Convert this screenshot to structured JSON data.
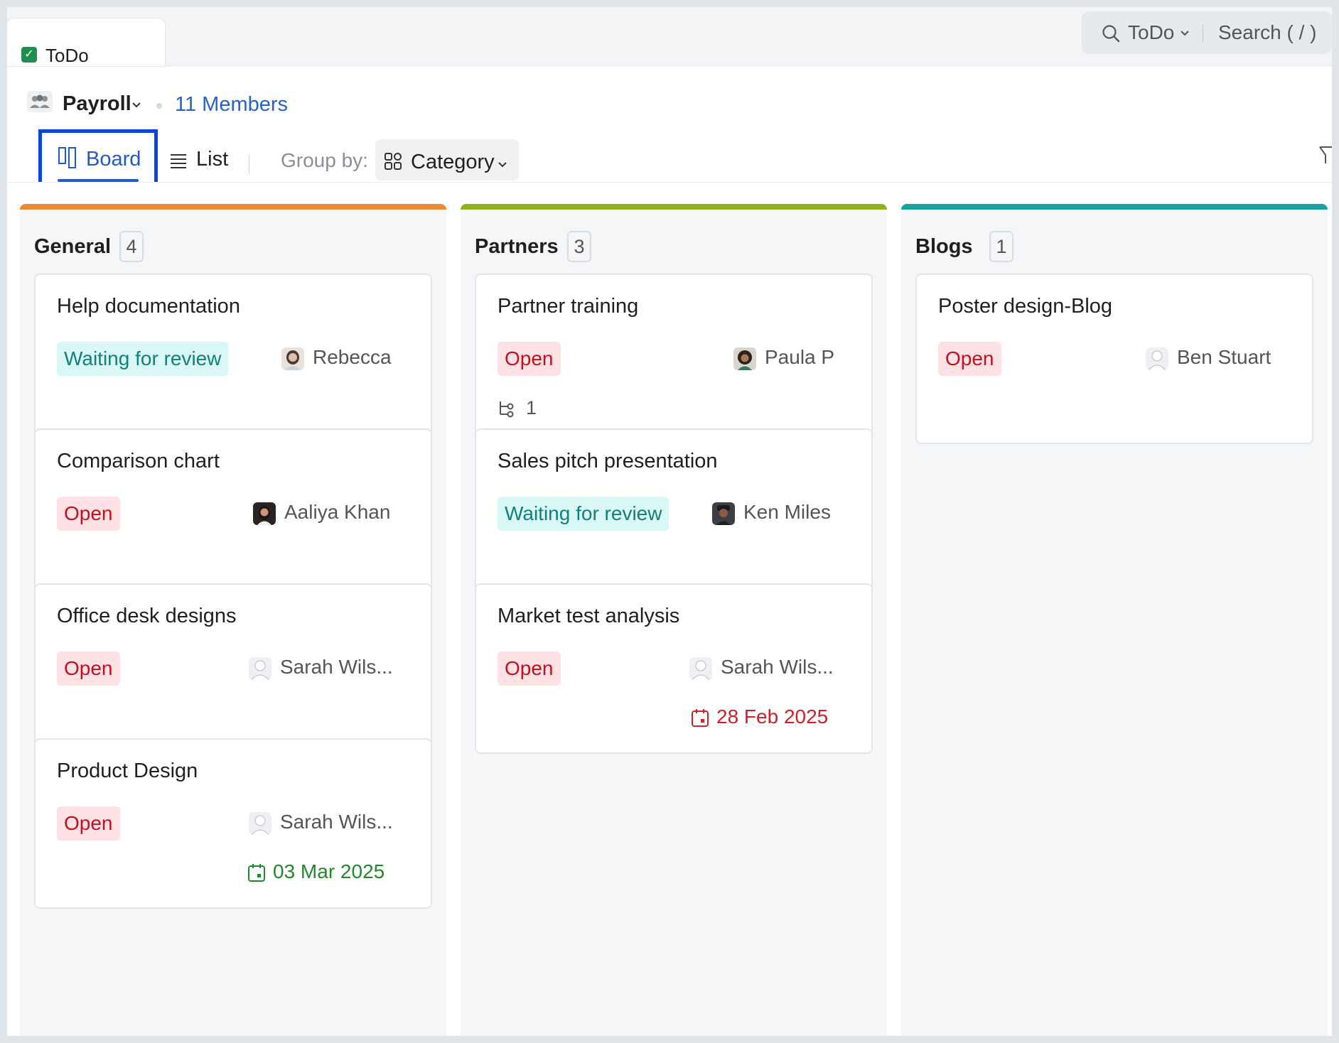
{
  "tab": {
    "label": "ToDo"
  },
  "search": {
    "scope": "ToDo",
    "placeholder": "Search ( / )"
  },
  "team": {
    "name": "Payroll",
    "members_link": "11 Members"
  },
  "views": {
    "board": "Board",
    "list": "List",
    "active": "Board"
  },
  "group_by": {
    "label": "Group by:",
    "value": "Category"
  },
  "colors": {
    "general_bar": "#e98a36",
    "partners_bar": "#8fb11f",
    "blogs_bar": "#1aa3a1",
    "open_bg": "#fde1e4",
    "open_text": "#c40f1f",
    "waiting_bg": "#d9f7f5",
    "waiting_text": "#11807a",
    "link": "#2563c4"
  },
  "columns": [
    {
      "title": "General",
      "count": "4",
      "cards": [
        {
          "title": "Help documentation",
          "status": "Waiting for review",
          "assignee": "Rebecca"
        },
        {
          "title": "Comparison chart",
          "status": "Open",
          "assignee": "Aaliya Khan"
        },
        {
          "title": "Office desk designs",
          "status": "Open",
          "assignee": "Sarah Wils..."
        },
        {
          "title": "Product Design",
          "status": "Open",
          "assignee": "Sarah Wils...",
          "due": "03 Mar 2025"
        }
      ]
    },
    {
      "title": "Partners",
      "count": "3",
      "cards": [
        {
          "title": "Partner training",
          "status": "Open",
          "assignee": "Paula P",
          "subtasks": "1"
        },
        {
          "title": "Sales pitch presentation",
          "status": "Waiting for review",
          "assignee": "Ken Miles"
        },
        {
          "title": "Market test analysis",
          "status": "Open",
          "assignee": "Sarah Wils...",
          "due": "28 Feb 2025"
        }
      ]
    },
    {
      "title": "Blogs",
      "count": "1",
      "cards": [
        {
          "title": "Poster design-Blog",
          "status": "Open",
          "assignee": "Ben Stuart"
        }
      ]
    }
  ]
}
